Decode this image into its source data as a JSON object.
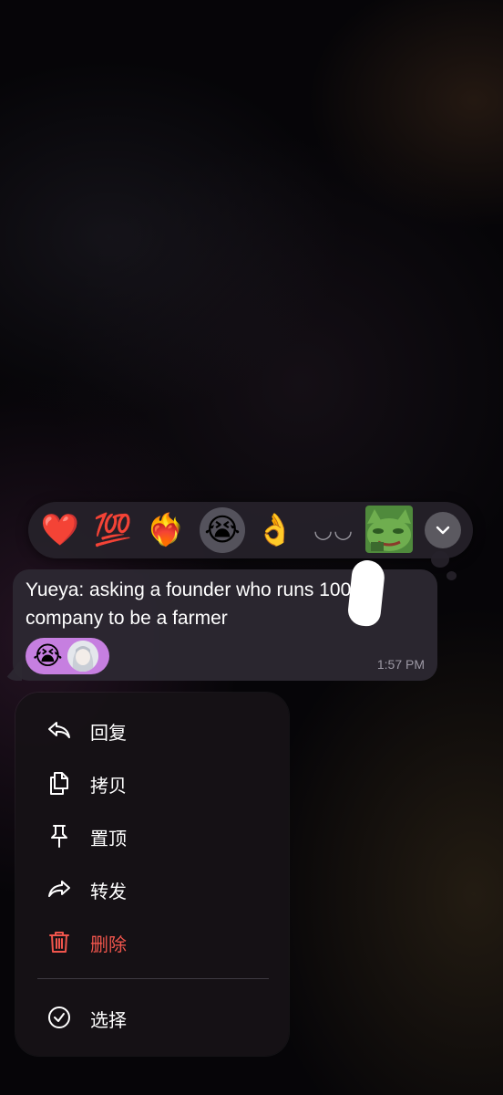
{
  "reaction_bar": {
    "reactions": [
      {
        "emoji": "❤️",
        "name": "red-heart"
      },
      {
        "emoji": "💯",
        "name": "hundred-points"
      },
      {
        "emoji": "❤️‍🔥",
        "name": "heart-on-fire"
      },
      {
        "emoji": "😭",
        "name": "loudly-crying",
        "selected": true
      },
      {
        "emoji": "👌",
        "name": "ok-hand"
      },
      {
        "emoji": "◡◡",
        "name": "closed-eyes"
      }
    ],
    "sticker": "frog-sticker-icon",
    "expand_icon": "chevron-down-icon"
  },
  "message": {
    "text": "Yueya: asking a founder who runs ​100M company to be a farmer",
    "reaction_chip": {
      "emoji": "😭"
    },
    "time": "1:57 PM"
  },
  "menu": {
    "items": [
      {
        "label": "回复",
        "icon": "reply-icon"
      },
      {
        "label": "拷贝",
        "icon": "copy-icon"
      },
      {
        "label": "置顶",
        "icon": "pin-icon"
      },
      {
        "label": "转发",
        "icon": "forward-icon"
      },
      {
        "label": "删除",
        "icon": "trash-icon",
        "color": "#f0554c"
      },
      {
        "label": "选择",
        "icon": "check-circle-icon"
      }
    ]
  },
  "colors": {
    "accent_chip": "#c67fe0",
    "danger": "#f0554c",
    "bubble": "#2c2832",
    "menu_bg": "#161216"
  }
}
